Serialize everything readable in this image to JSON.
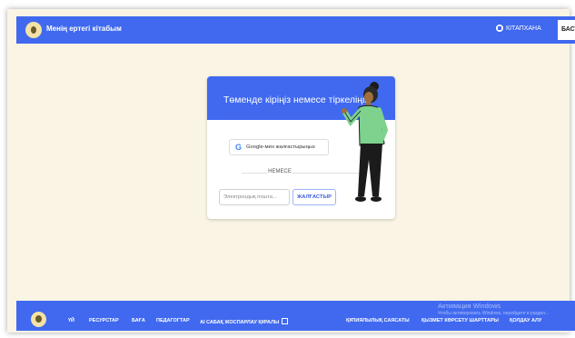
{
  "header": {
    "app_title": "Менің ертегі кітабым",
    "library_label": "КІТАПХАНА",
    "start_label": "БАСТА",
    "logo_icon": "owl-logo-icon",
    "library_icon": "book-icon"
  },
  "card": {
    "title": "Төменде кіріңіз немесе тіркеліңіз",
    "google_button": "Google-мен жалғастырыңыз",
    "google_icon": "google-g-icon",
    "or_text": "НЕМЕСЕ",
    "email_placeholder": "Электрондық пошта...",
    "submit_label": "ЖАЛҒАСТЫР"
  },
  "footer": {
    "links": [
      "ҮЙ",
      "РЕСУРСТАР",
      "БАҒА",
      "ПЕДАГОГТАР",
      "AI САБАҚ ЖОСПАРЛАУ ҚҰРАЛЫ"
    ],
    "right_links": [
      "ҚҰПИЯЛЫЛЫҚ САЯСАТЫ",
      "ҚЫЗМЕТ КӨРСЕТУ ШАРТТАРЫ",
      "ҚОЛДАУ АЛУ"
    ],
    "watermark_title": "Активация Windows",
    "watermark_sub": "Чтобы активировать Windows, перейдите в раздел..."
  },
  "colors": {
    "brand_blue": "#4069f0",
    "page_bg": "#f9f4e4"
  }
}
